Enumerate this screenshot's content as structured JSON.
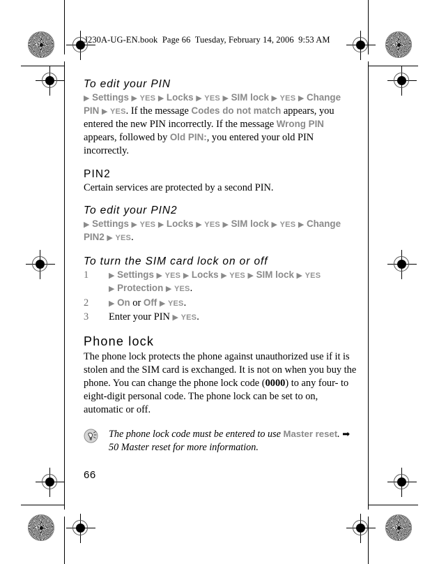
{
  "document": {
    "header_text": "J230A-UG-EN.book  Page 66  Tuesday, February 14, 2006  9:53 AM",
    "header_filename": "J230A-UG-EN.book",
    "header_page_label": "Page 66",
    "header_date": "Tuesday, February 14, 2006",
    "header_time": "9:53 AM",
    "folio": "66"
  },
  "colors": {
    "ui_reference_gray": "#8a8a8a",
    "key_gray": "#949494",
    "list_number_gray": "#6f6f6f",
    "body_black": "#000000",
    "page_background": "#ffffff"
  },
  "glyphs": {
    "step_triangle": "▶",
    "xref_arrow": "➡"
  },
  "sections": [
    {
      "id": "edit-pin",
      "heading": "To edit your PIN",
      "heading_style": "procedure",
      "path": [
        {
          "text": "Settings",
          "style": "ui"
        },
        {
          "text": "YES",
          "style": "key"
        },
        {
          "text": "Locks",
          "style": "ui"
        },
        {
          "text": "YES",
          "style": "key"
        },
        {
          "text": "SIM lock",
          "style": "ui"
        },
        {
          "text": "YES",
          "style": "key"
        },
        {
          "text": "Change PIN",
          "style": "ui"
        },
        {
          "text": "YES",
          "style": "key"
        }
      ],
      "trailing_text_1": ". If the message ",
      "inline_ui_1": "Codes do not match",
      "trailing_text_2": " appears, you entered the new PIN incorrectly. If the message ",
      "inline_ui_2": "Wrong PIN",
      "trailing_text_3": " appears, followed by ",
      "inline_ui_3": "Old PIN:",
      "trailing_text_4": ", you entered your old PIN incorrectly."
    },
    {
      "id": "pin2",
      "heading": "PIN2",
      "heading_style": "section",
      "body": "Certain services are protected by a second PIN."
    },
    {
      "id": "edit-pin2",
      "heading": "To edit your PIN2",
      "heading_style": "procedure",
      "path": [
        {
          "text": "Settings",
          "style": "ui"
        },
        {
          "text": "YES",
          "style": "key"
        },
        {
          "text": "Locks",
          "style": "ui"
        },
        {
          "text": "YES",
          "style": "key"
        },
        {
          "text": "SIM lock",
          "style": "ui"
        },
        {
          "text": "YES",
          "style": "key"
        },
        {
          "text": "Change PIN2",
          "style": "ui"
        },
        {
          "text": "YES",
          "style": "key"
        }
      ],
      "trailing_text_1": "."
    },
    {
      "id": "sim-card-lock",
      "heading": "To turn the SIM card lock on or off",
      "heading_style": "procedure",
      "steps": [
        {
          "number": "1",
          "path": [
            {
              "text": "Settings",
              "style": "ui"
            },
            {
              "text": "YES",
              "style": "key"
            },
            {
              "text": "Locks",
              "style": "ui"
            },
            {
              "text": "YES",
              "style": "key"
            },
            {
              "text": "SIM lock",
              "style": "ui"
            },
            {
              "text": "YES",
              "style": "key"
            },
            {
              "text": "Protection",
              "style": "ui"
            },
            {
              "text": "YES",
              "style": "key"
            }
          ],
          "trailing": "."
        },
        {
          "number": "2",
          "path": [
            {
              "text": "On",
              "style": "ui"
            },
            {
              "text": "or",
              "style": "serif"
            },
            {
              "text": "Off",
              "style": "ui"
            },
            {
              "text": "YES",
              "style": "key"
            }
          ],
          "trailing": "."
        },
        {
          "number": "3",
          "lead_text": "Enter your PIN ",
          "path": [
            {
              "text": "YES",
              "style": "key"
            }
          ],
          "trailing": "."
        }
      ]
    },
    {
      "id": "phone-lock",
      "heading": "Phone lock",
      "heading_style": "section-big",
      "body_part_1": "The phone lock protects the phone against unauthorized use if it is stolen and the SIM card is exchanged. It is not on when you buy the phone. You can change the phone lock code (",
      "body_code": "0000",
      "body_part_2": ") to any four- to eight-digit personal code. The phone lock can be set to on, automatic or off."
    }
  ],
  "note": {
    "icon_name": "tip-lightbulb-icon",
    "text_part_1": "The phone lock code must be entered to use ",
    "ui_reference": "Master reset",
    "text_part_2": ". ",
    "arrow": "➡",
    "text_part_3": " 50 Master reset for more information."
  }
}
